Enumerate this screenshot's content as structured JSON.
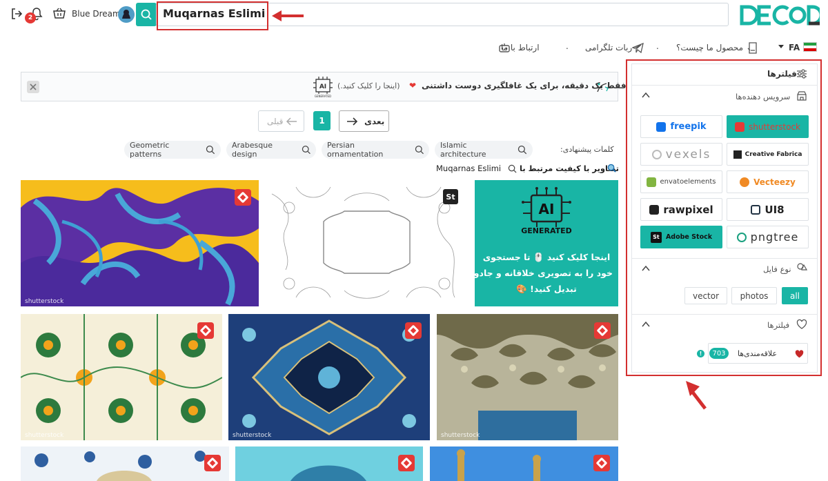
{
  "header": {
    "notification_count": "2",
    "username": "Blue Dream",
    "search_value": "Muqarnas Eslimi",
    "logo_text": "DECOD"
  },
  "nav": {
    "lang": "FA",
    "product_link": "محصول ما چیست؟",
    "telegram_link": "ربات تلگرامی",
    "contact_link": "ارتباط با ما",
    "sep": "."
  },
  "banner": {
    "text": "فقط یک دقیقه، برای یک غافلگیری دوست داشتنی",
    "link": "(اینجا را کلیک کنید.)",
    "ai_badge": "AI"
  },
  "pagination": {
    "next_label": "بعدی",
    "prev_label": "قبلی",
    "current_page": "1"
  },
  "suggestions": {
    "label": "کلمات پیشنهادی:",
    "items": [
      "Islamic architecture",
      "Persian ornamentation",
      "Arabesque design",
      "Geometric patterns"
    ]
  },
  "related": {
    "label": "تصاویر با کیفیت مرتبط با",
    "query": "Muqarnas Eslimi"
  },
  "ai_card": {
    "badge": "AI",
    "badge_sub": "GENERATED",
    "line1": "اینجا کلیک کنید 🖱️ تا جستجوی",
    "line2": "خود را به تصویری خلاقانه و جادویی",
    "line3": "تبدیل کنید! 🎨"
  },
  "sidebar": {
    "title": "فیلترها",
    "providers_title": "سرویس دهنده‌ها",
    "providers": [
      {
        "name": "shutterstock",
        "selected": true
      },
      {
        "name": "freepik",
        "selected": false
      },
      {
        "name": "Creative Fabrica",
        "selected": false
      },
      {
        "name": "vexels",
        "selected": false
      },
      {
        "name": "Vecteezy",
        "selected": false
      },
      {
        "name": "envatoelements",
        "selected": false
      },
      {
        "name": "UI8",
        "selected": false
      },
      {
        "name": "rawpixel",
        "selected": false
      },
      {
        "name": "pngtree",
        "selected": false
      },
      {
        "name": "Adobe Stock",
        "selected": false
      }
    ],
    "filetype_title": "نوع فایل",
    "filetypes": [
      "all",
      "photos",
      "vector"
    ],
    "favorites_title": "فیلترها",
    "favorites_label": "علاقه‌مندی‌ها",
    "favorites_count": "703"
  },
  "images": {
    "watermark": "shutterstock",
    "stock_badge": "St"
  },
  "colors": {
    "accent": "#19b5a5",
    "highlight": "#d32f2f",
    "shutterstock_red": "#e53935"
  }
}
